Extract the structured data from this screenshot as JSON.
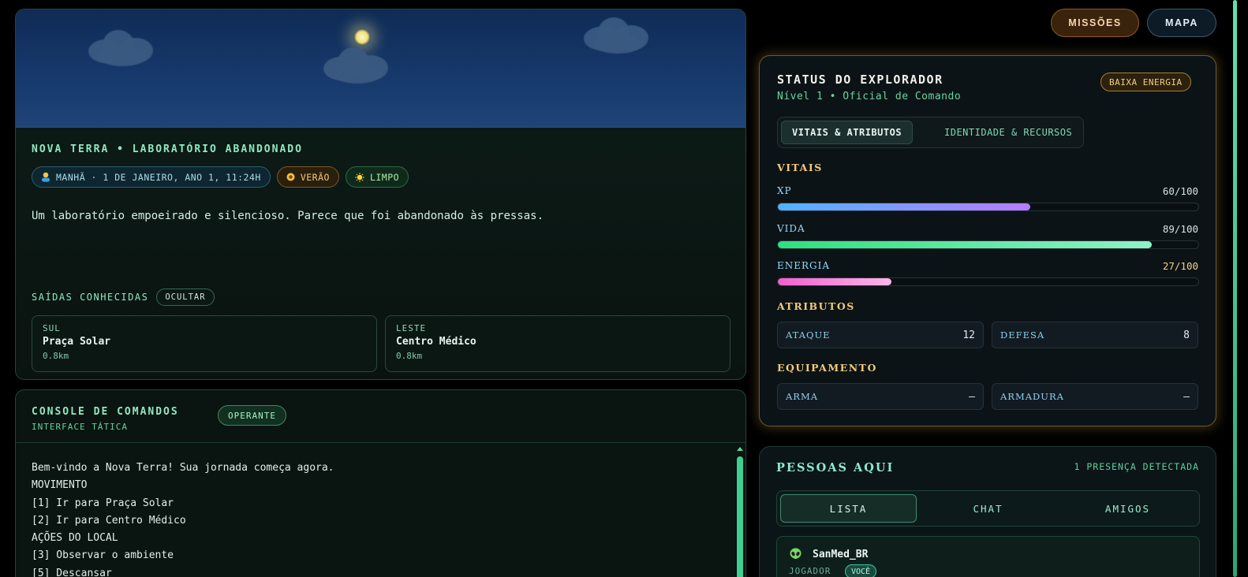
{
  "location": {
    "title": "NOVA TERRA • LABORATÓRIO ABANDONADO",
    "time_chip": "MANHÃ · 1 DE JANEIRO, ANO 1, 11:24H",
    "season_chip": "VERÃO",
    "weather_chip": "LIMPO",
    "description": "Um laboratório empoeirado e silencioso. Parece que foi abandonado às pressas.",
    "exits_title": "SAÍDAS CONHECIDAS",
    "hide_label": "OCULTAR",
    "exits": [
      {
        "direction": "SUL",
        "name": "Praça Solar",
        "distance": "0.8km"
      },
      {
        "direction": "LESTE",
        "name": "Centro Médico",
        "distance": "0.8km"
      }
    ]
  },
  "console": {
    "title": "CONSOLE DE COMANDOS",
    "subtitle": "INTERFACE TÁTICA",
    "status": "OPERANTE",
    "lines": [
      "Bem-vindo a Nova Terra! Sua jornada começa agora.",
      "MOVIMENTO",
      "[1] Ir para Praça Solar",
      "[2] Ir para Centro Médico",
      "AÇÕES DO LOCAL",
      "[3] Observar o ambiente",
      "[5] Descansar"
    ]
  },
  "top_buttons": {
    "missions": "MISSÕES",
    "map": "MAPA"
  },
  "status": {
    "title": "STATUS DO EXPLORADOR",
    "subtitle": "Nível 1 • Oficial de Comando",
    "badge": "BAIXA ENERGIA",
    "tabs": [
      "VITAIS & ATRIBUTOS",
      "IDENTIDADE & RECURSOS"
    ],
    "vitals_title": "VITAIS",
    "bars": [
      {
        "label": "XP",
        "value_text": "60/100",
        "value": 60,
        "max": 100,
        "gradient": [
          "#4fb3ff",
          "#b77cff"
        ],
        "value_color": "#d6e2e6"
      },
      {
        "label": "VIDA",
        "value_text": "89/100",
        "value": 89,
        "max": 100,
        "gradient": [
          "#2ee07d",
          "#8ff2c6"
        ],
        "value_color": "#d6e2e6"
      },
      {
        "label": "ENERGIA",
        "value_text": "27/100",
        "value": 27,
        "max": 100,
        "gradient": [
          "#f25fd0",
          "#fbb6ea"
        ],
        "value_color": "#f3cf85"
      }
    ],
    "attributes_title": "ATRIBUTOS",
    "attributes": [
      {
        "key": "ATAQUE",
        "value": "12"
      },
      {
        "key": "DEFESA",
        "value": "8"
      }
    ],
    "equipment_title": "EQUIPAMENTO",
    "equipment": [
      {
        "key": "ARMA",
        "value": "–"
      },
      {
        "key": "ARMADURA",
        "value": "–"
      }
    ]
  },
  "people": {
    "title": "PESSOAS AQUI",
    "count": "1 PRESENÇA DETECTADA",
    "tabs": [
      "LISTA",
      "CHAT",
      "AMIGOS"
    ],
    "list": [
      {
        "name": "SanMed_BR",
        "role": "JOGADOR",
        "tag": "VOCÊ",
        "icon": "alien-icon"
      }
    ]
  },
  "colors": {
    "accent": "#8fe8c0",
    "warning": "#f2c97a",
    "brand_green": "#3fcf8e"
  }
}
